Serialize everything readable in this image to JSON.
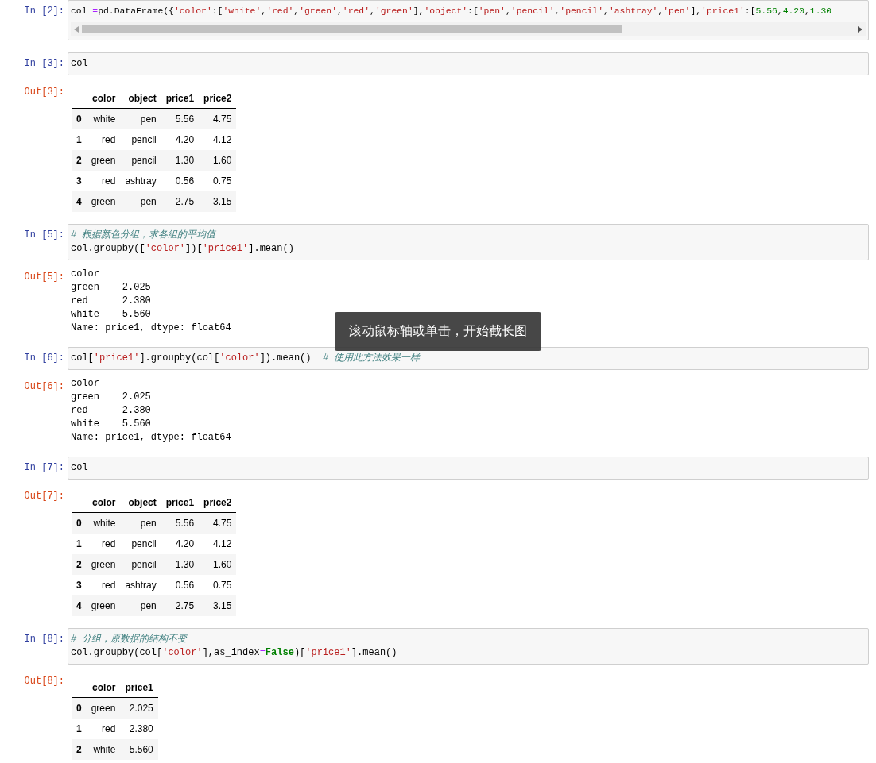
{
  "cells": [
    {
      "prompt": "In [2]:",
      "horizontal_scroll": true,
      "lines": [
        [
          {
            "kind": "plain",
            "text": "col "
          },
          {
            "kind": "operator",
            "text": "="
          },
          {
            "kind": "plain",
            "text": "pd.DataFrame({"
          },
          {
            "kind": "string",
            "text": "'color'"
          },
          {
            "kind": "plain",
            "text": ":["
          },
          {
            "kind": "string",
            "text": "'white'"
          },
          {
            "kind": "plain",
            "text": ","
          },
          {
            "kind": "string",
            "text": "'red'"
          },
          {
            "kind": "plain",
            "text": ","
          },
          {
            "kind": "string",
            "text": "'green'"
          },
          {
            "kind": "plain",
            "text": ","
          },
          {
            "kind": "string",
            "text": "'red'"
          },
          {
            "kind": "plain",
            "text": ","
          },
          {
            "kind": "string",
            "text": "'green'"
          },
          {
            "kind": "plain",
            "text": "],"
          },
          {
            "kind": "string",
            "text": "'object'"
          },
          {
            "kind": "plain",
            "text": ":["
          },
          {
            "kind": "string",
            "text": "'pen'"
          },
          {
            "kind": "plain",
            "text": ","
          },
          {
            "kind": "string",
            "text": "'pencil'"
          },
          {
            "kind": "plain",
            "text": ","
          },
          {
            "kind": "string",
            "text": "'pencil'"
          },
          {
            "kind": "plain",
            "text": ","
          },
          {
            "kind": "string",
            "text": "'ashtray'"
          },
          {
            "kind": "plain",
            "text": ","
          },
          {
            "kind": "string",
            "text": "'pen'"
          },
          {
            "kind": "plain",
            "text": "],"
          },
          {
            "kind": "string",
            "text": "'price1'"
          },
          {
            "kind": "plain",
            "text": ":["
          },
          {
            "kind": "number",
            "text": "5.56"
          },
          {
            "kind": "plain",
            "text": ","
          },
          {
            "kind": "number",
            "text": "4.20"
          },
          {
            "kind": "plain",
            "text": ","
          },
          {
            "kind": "number",
            "text": "1.30"
          }
        ]
      ]
    },
    {
      "prompt": "In [3]:",
      "lines": [
        [
          {
            "kind": "plain",
            "text": "col"
          }
        ]
      ],
      "output": {
        "prompt": "Out[3]:",
        "kind": "table",
        "columns": [
          "color",
          "object",
          "price1",
          "price2"
        ],
        "rows": [
          {
            "index": "0",
            "cells": [
              "white",
              "pen",
              "5.56",
              "4.75"
            ]
          },
          {
            "index": "1",
            "cells": [
              "red",
              "pencil",
              "4.20",
              "4.12"
            ]
          },
          {
            "index": "2",
            "cells": [
              "green",
              "pencil",
              "1.30",
              "1.60"
            ]
          },
          {
            "index": "3",
            "cells": [
              "red",
              "ashtray",
              "0.56",
              "0.75"
            ]
          },
          {
            "index": "4",
            "cells": [
              "green",
              "pen",
              "2.75",
              "3.15"
            ]
          }
        ]
      }
    },
    {
      "prompt": "In [5]:",
      "lines": [
        [
          {
            "kind": "comment",
            "text": "# 根据颜色分组，求各组的平均值"
          }
        ],
        [
          {
            "kind": "plain",
            "text": "col.groupby(["
          },
          {
            "kind": "string",
            "text": "'color'"
          },
          {
            "kind": "plain",
            "text": "])["
          },
          {
            "kind": "string",
            "text": "'price1'"
          },
          {
            "kind": "plain",
            "text": "].mean()"
          }
        ]
      ],
      "output": {
        "prompt": "Out[5]:",
        "kind": "text",
        "lines": [
          "color",
          "green    2.025",
          "red      2.380",
          "white    5.560",
          "Name: price1, dtype: float64"
        ]
      }
    },
    {
      "prompt": "In [6]:",
      "lines": [
        [
          {
            "kind": "plain",
            "text": "col["
          },
          {
            "kind": "string",
            "text": "'price1'"
          },
          {
            "kind": "plain",
            "text": "].groupby(col["
          },
          {
            "kind": "string",
            "text": "'color'"
          },
          {
            "kind": "plain",
            "text": "]).mean()  "
          },
          {
            "kind": "comment",
            "text": "# 使用此方法效果一样"
          }
        ]
      ],
      "output": {
        "prompt": "Out[6]:",
        "kind": "text",
        "lines": [
          "color",
          "green    2.025",
          "red      2.380",
          "white    5.560",
          "Name: price1, dtype: float64"
        ]
      }
    },
    {
      "prompt": "In [7]:",
      "lines": [
        [
          {
            "kind": "plain",
            "text": "col"
          }
        ]
      ],
      "output": {
        "prompt": "Out[7]:",
        "kind": "table",
        "columns": [
          "color",
          "object",
          "price1",
          "price2"
        ],
        "rows": [
          {
            "index": "0",
            "cells": [
              "white",
              "pen",
              "5.56",
              "4.75"
            ]
          },
          {
            "index": "1",
            "cells": [
              "red",
              "pencil",
              "4.20",
              "4.12"
            ]
          },
          {
            "index": "2",
            "cells": [
              "green",
              "pencil",
              "1.30",
              "1.60"
            ]
          },
          {
            "index": "3",
            "cells": [
              "red",
              "ashtray",
              "0.56",
              "0.75"
            ]
          },
          {
            "index": "4",
            "cells": [
              "green",
              "pen",
              "2.75",
              "3.15"
            ]
          }
        ]
      }
    },
    {
      "prompt": "In [8]:",
      "lines": [
        [
          {
            "kind": "comment",
            "text": "# 分组，原数据的结构不变"
          }
        ],
        [
          {
            "kind": "plain",
            "text": "col.groupby(col["
          },
          {
            "kind": "string",
            "text": "'color'"
          },
          {
            "kind": "plain",
            "text": "],as_index"
          },
          {
            "kind": "operator",
            "text": "="
          },
          {
            "kind": "keyword",
            "text": "False"
          },
          {
            "kind": "plain",
            "text": ")["
          },
          {
            "kind": "string",
            "text": "'price1'"
          },
          {
            "kind": "plain",
            "text": "].mean()"
          }
        ]
      ],
      "output": {
        "prompt": "Out[8]:",
        "kind": "table",
        "columns": [
          "color",
          "price1"
        ],
        "rows": [
          {
            "index": "0",
            "cells": [
              "green",
              "2.025"
            ]
          },
          {
            "index": "1",
            "cells": [
              "red",
              "2.380"
            ]
          },
          {
            "index": "2",
            "cells": [
              "white",
              "5.560"
            ]
          }
        ]
      }
    }
  ],
  "tooltip": {
    "text": "滚动鼠标轴或单击，开始截长图"
  }
}
